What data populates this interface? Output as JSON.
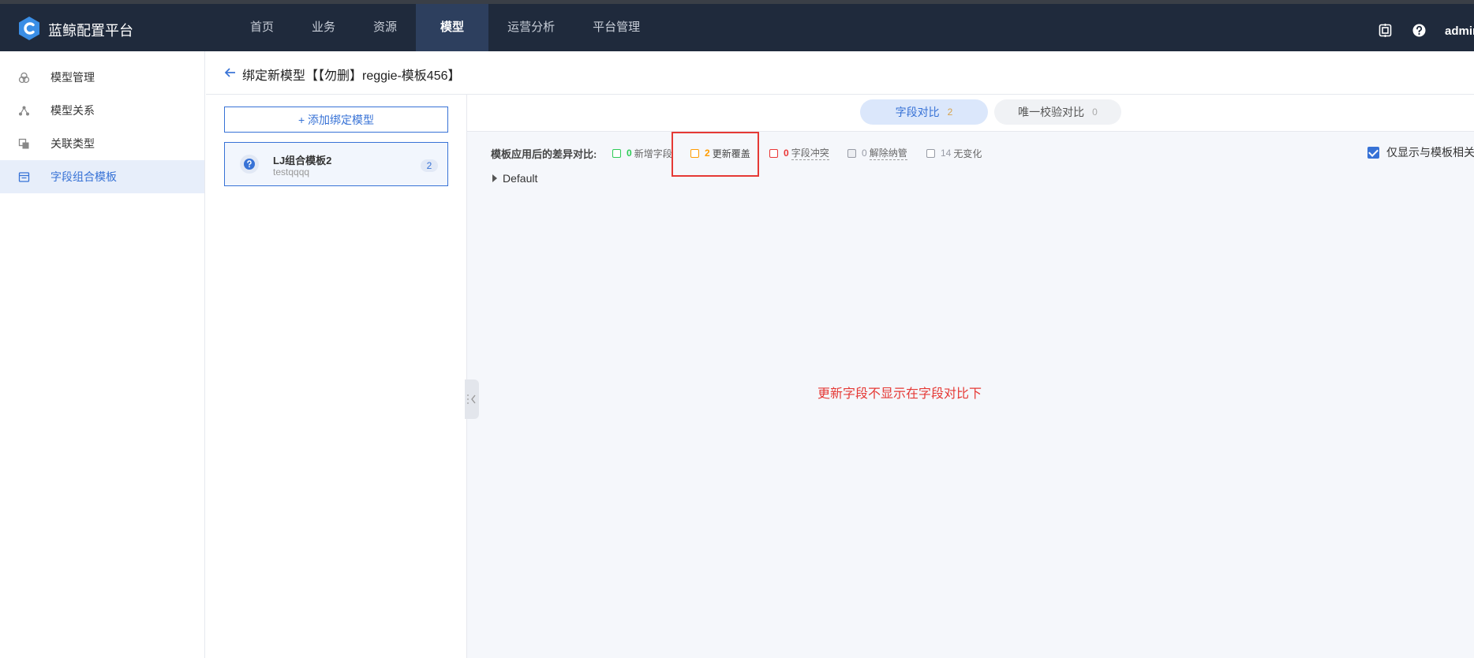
{
  "app": {
    "title": "蓝鲸配置平台",
    "brand_color": "#3a8ee6"
  },
  "nav": {
    "items": [
      {
        "label": "首页",
        "active": false
      },
      {
        "label": "业务",
        "active": false
      },
      {
        "label": "资源",
        "active": false
      },
      {
        "label": "模型",
        "active": true
      },
      {
        "label": "运营分析",
        "active": false
      },
      {
        "label": "平台管理",
        "active": false
      }
    ]
  },
  "topbar": {
    "user": "admin"
  },
  "sidebar": {
    "items": [
      {
        "label": "模型管理",
        "icon": "model-management-icon",
        "active": false
      },
      {
        "label": "模型关系",
        "icon": "model-relation-icon",
        "active": false
      },
      {
        "label": "关联类型",
        "icon": "association-type-icon",
        "active": false
      },
      {
        "label": "字段组合模板",
        "icon": "field-template-icon",
        "active": true
      }
    ]
  },
  "header": {
    "title": "绑定新模型【【勿删】reggie-模板456】"
  },
  "left_panel": {
    "add_button": "+ 添加绑定模型",
    "cards": [
      {
        "title": "LJ组合模板2",
        "subtitle": "testqqqq",
        "badge": "2"
      }
    ]
  },
  "tabs": [
    {
      "label": "字段对比",
      "count": "2",
      "active": true
    },
    {
      "label": "唯一校验对比",
      "count": "0",
      "active": false
    }
  ],
  "diff": {
    "label": "模板应用后的差异对比:",
    "legend": [
      {
        "count": "0",
        "label": "新增字段",
        "color": "#2dcb56",
        "dashed": false
      },
      {
        "count": "2",
        "label": "更新覆盖",
        "color": "#ff9c01",
        "dashed": false
      },
      {
        "count": "0",
        "label": "字段冲突",
        "color": "#ea3636",
        "dashed": true
      },
      {
        "count": "0",
        "label": "解除纳管",
        "color": "#979ba5",
        "dashed": true
      },
      {
        "count": "14",
        "label": "无变化",
        "color": "#979ba5",
        "dashed": false
      }
    ],
    "only_show_label": "仅显示与模板相关"
  },
  "group": {
    "label": "Default"
  },
  "annotation": "更新字段不显示在字段对比下"
}
